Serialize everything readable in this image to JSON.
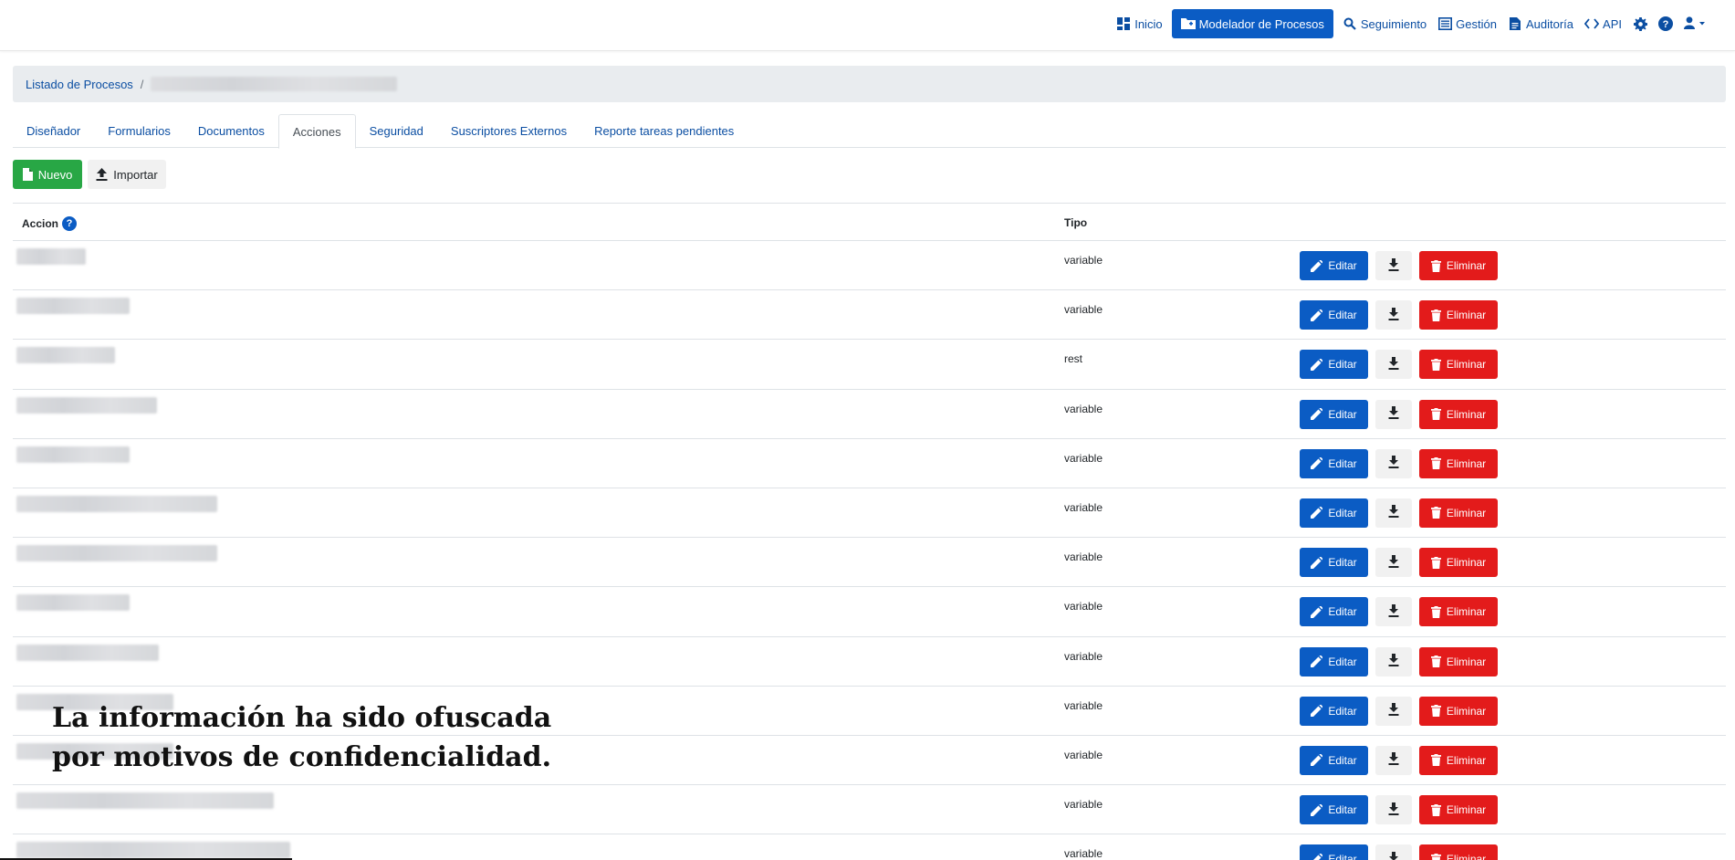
{
  "nav": {
    "items": [
      {
        "label": "Inicio",
        "icon": "dashboard-icon"
      },
      {
        "label": "Modelador de Procesos",
        "icon": "folder-plus-icon",
        "active": true
      },
      {
        "label": "Seguimiento",
        "icon": "search-icon"
      },
      {
        "label": "Gestión",
        "icon": "list-icon"
      },
      {
        "label": "Auditoría",
        "icon": "document-icon"
      },
      {
        "label": "API",
        "icon": "code-icon"
      }
    ],
    "icons": [
      "gear-icon",
      "help-icon",
      "user-icon"
    ]
  },
  "breadcrumb": {
    "root": "Listado de Procesos",
    "separator": "/"
  },
  "tabs": [
    {
      "label": "Diseñador"
    },
    {
      "label": "Formularios"
    },
    {
      "label": "Documentos"
    },
    {
      "label": "Acciones",
      "active": true
    },
    {
      "label": "Seguridad"
    },
    {
      "label": "Suscriptores Externos"
    },
    {
      "label": "Reporte tareas pendientes"
    }
  ],
  "toolbar": {
    "new_label": "Nuevo",
    "import_label": "Importar"
  },
  "table": {
    "col_accion": "Accion",
    "col_tipo": "Tipo",
    "help_glyph": "?",
    "edit_label": "Editar",
    "delete_label": "Eliminar",
    "rows": [
      {
        "tipo": "variable"
      },
      {
        "tipo": "variable"
      },
      {
        "tipo": "rest"
      },
      {
        "tipo": "variable"
      },
      {
        "tipo": "variable"
      },
      {
        "tipo": "variable"
      },
      {
        "tipo": "variable"
      },
      {
        "tipo": "variable"
      },
      {
        "tipo": "variable"
      },
      {
        "tipo": "variable"
      },
      {
        "tipo": "variable"
      },
      {
        "tipo": "variable"
      },
      {
        "tipo": "variable"
      }
    ]
  },
  "watermark": {
    "line1": "La información ha sido ofuscada",
    "line2": "por motivos de confidencialidad."
  },
  "colors": {
    "primary": "#0b5cc4",
    "link": "#0b4ea2",
    "success": "#28a745",
    "danger": "#e31b1b"
  }
}
